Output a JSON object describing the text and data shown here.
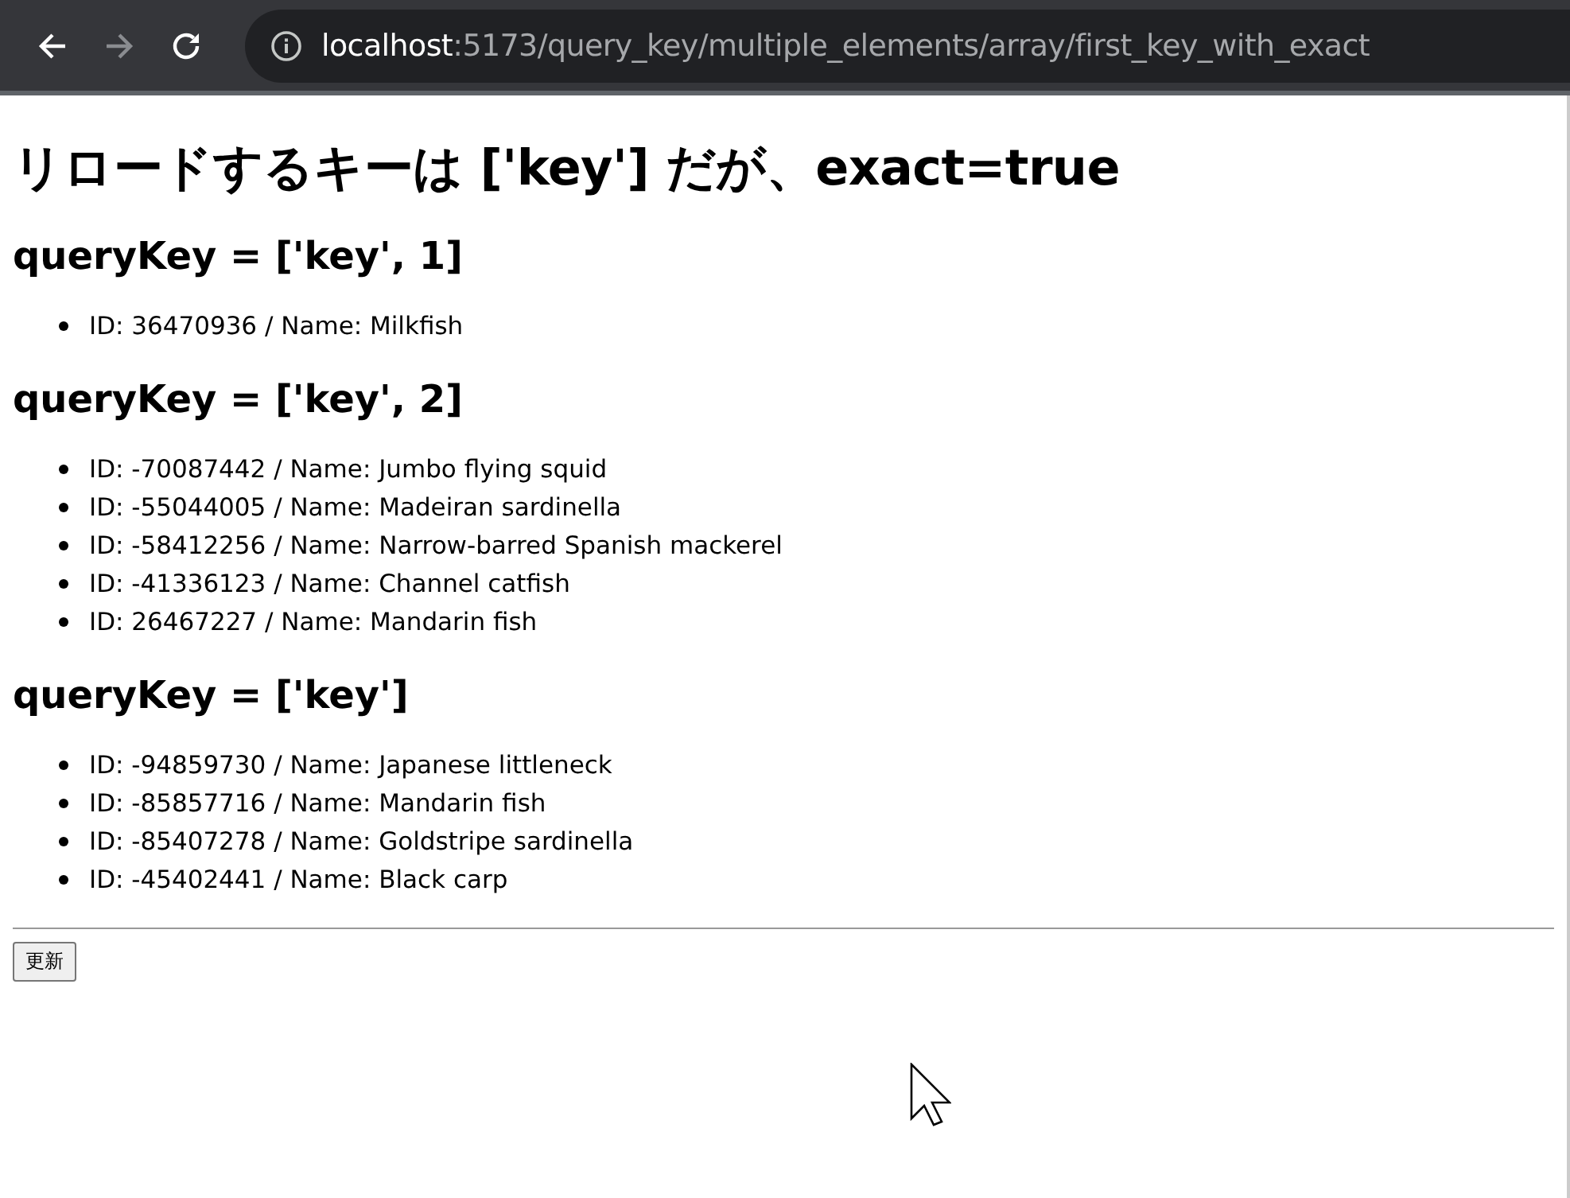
{
  "toolbar": {
    "back": {
      "disabled": false
    },
    "forward": {
      "disabled": true
    },
    "url": {
      "host": "localhost",
      "path": ":5173/query_key/multiple_elements/array/first_key_with_exact"
    }
  },
  "page": {
    "title": "リロードするキーは ['key'] だが、exact=true",
    "sections": [
      {
        "heading": "queryKey = ['key', 1]",
        "items": [
          "ID: 36470936 / Name: Milkfish"
        ]
      },
      {
        "heading": "queryKey = ['key', 2]",
        "items": [
          "ID: -70087442 / Name: Jumbo flying squid",
          "ID: -55044005 / Name: Madeiran sardinella",
          "ID: -58412256 / Name: Narrow-barred Spanish mackerel",
          "ID: -41336123 / Name: Channel catfish",
          "ID: 26467227 / Name: Mandarin fish"
        ]
      },
      {
        "heading": "queryKey = ['key']",
        "items": [
          "ID: -94859730 / Name: Japanese littleneck",
          "ID: -85857716 / Name: Mandarin fish",
          "ID: -85407278 / Name: Goldstripe sardinella",
          "ID: -45402441 / Name: Black carp"
        ]
      }
    ],
    "button": "更新"
  }
}
